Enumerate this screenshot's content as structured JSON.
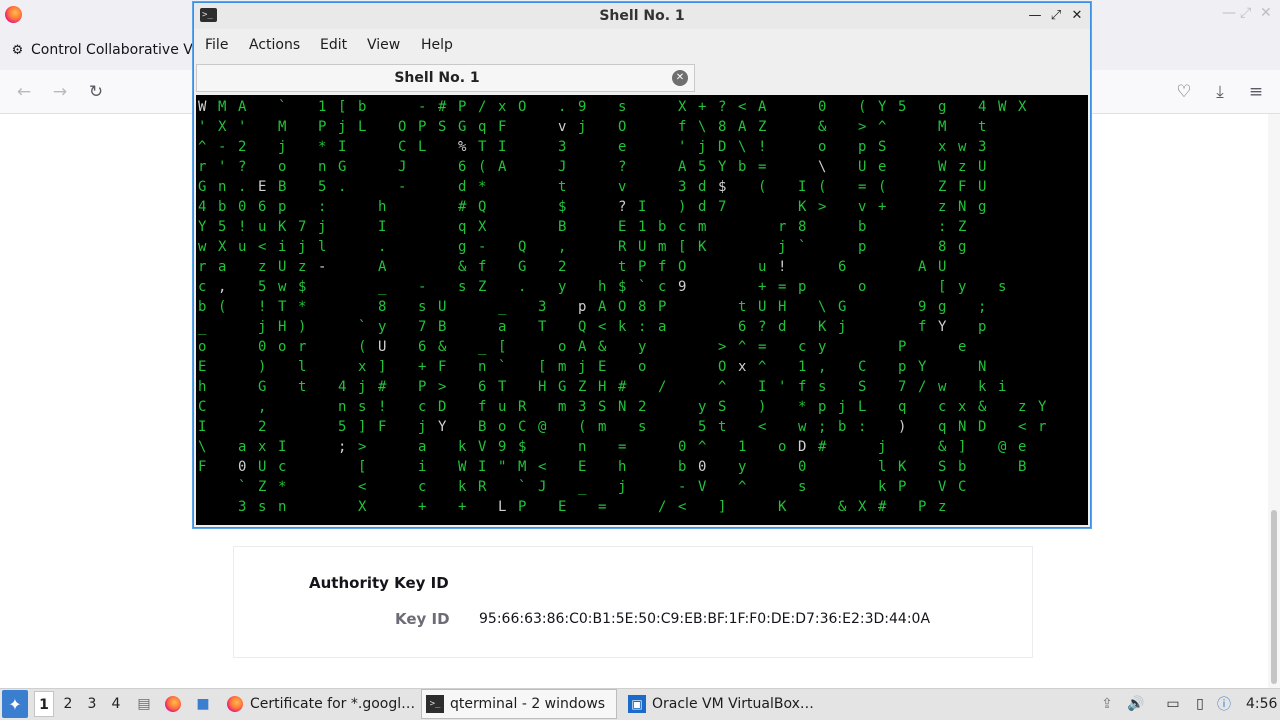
{
  "browser": {
    "active_tab_title": "Control Collaborative Vi",
    "window_controls": [
      "—",
      "⤢",
      "✕"
    ]
  },
  "certificate": {
    "section_title": "Authority Key ID",
    "key_id_label": "Key ID",
    "key_id_value": "95:66:63:86:C0:B1:5E:50:C9:EB:BF:1F:F0:DE:D7:36:E2:3D:44:0A"
  },
  "terminal": {
    "window_title": "Shell No. 1",
    "tab_title": "Shell No. 1",
    "menu": {
      "file": "File",
      "actions": "Actions",
      "edit": "Edit",
      "view": "View",
      "help": "Help"
    },
    "colors": {
      "background": "#000000",
      "text": "#22c33a",
      "highlight": "#d0d0d0"
    },
    "screen_rows": [
      "W M A   `   1 [ b     - # P / x O   . 9   s     X + ? < A     0   ( Y 5   g   4 W X",
      "' X '   M   P j L   O P S G q F     v j   O     f \\ 8 A Z     &   > ^     M   t",
      "^ - 2   j   * I     C L   % T I     3     e     ' j D \\ !     o   p S     x w 3",
      "r ' ?   o   n G     J     6 ( A     J     ?     A 5 Y b =     \\   U e     W z U",
      "G n . E B   5 .     -     d *       t     v     3 d $   (   I (   = (     Z F U",
      "4 b 0 6 p   :     h       # Q       $     ? I   ) d 7       K >   v +     z N g",
      "Y 5 ! u K 7 j     I       q X       B     E 1 b c m       r 8     b       : Z",
      "w X u < i j l     .       g -   Q   ,     R U m [ K       j `     p       8 g",
      "r a   z U z -     A       & f   G   2     t P f O       u !     6       A U",
      "c ,   5 w $       _   -   s Z   .   y   h $ ` c 9       + = p     o       [ y   s",
      "b (   ! T *       8   s U     _   3   p A O 8 P       t U H   \\ G       9 g   ;",
      "_     j H )     ` y   7 B     a   T   Q < k : a       6 ? d   K j       f Y   p",
      "o     0 o r     ( U   6 &   _ [     o A &   y       > ^ =   c y       P     e",
      "E     )   l     x ]   + F   n `   [ m j E   o       O x ^   1 ,   C   p Y     N",
      "h     G   t   4 j #   P >   6 T   H G Z H #   /     ^   I ' f s   S   7 / w   k i",
      "C     ,       n s !   c D   f u R   m 3 S N 2     y S   )   * p j L   q   c x &   z Y",
      "I     2       5 ] F   j Y   B o C @   ( m   s     5 t   <   w ; b :   )   q N D   < r",
      "\\   a x I     ; >     a   k V 9 $     n   =     0 ^   1   o D #     j     & ]   @ e",
      "F   0 U c       [     i   W I \" M <   E   h     b 0   y     0       l K   S b     B",
      "    ` Z *       <     c   k R   ` J   _   j     - V   ^     s       k P   V C",
      "    3 s n       X     +   +   L P   E   =     / <   ]     K     & X #   P z"
    ]
  },
  "taskbar": {
    "workspaces": [
      "1",
      "2",
      "3",
      "4"
    ],
    "tasks": [
      {
        "label": "Certificate for *.googl…"
      },
      {
        "label": "qterminal - 2 windows"
      },
      {
        "label": "Oracle VM VirtualBox…"
      }
    ],
    "clock": "4:56"
  }
}
